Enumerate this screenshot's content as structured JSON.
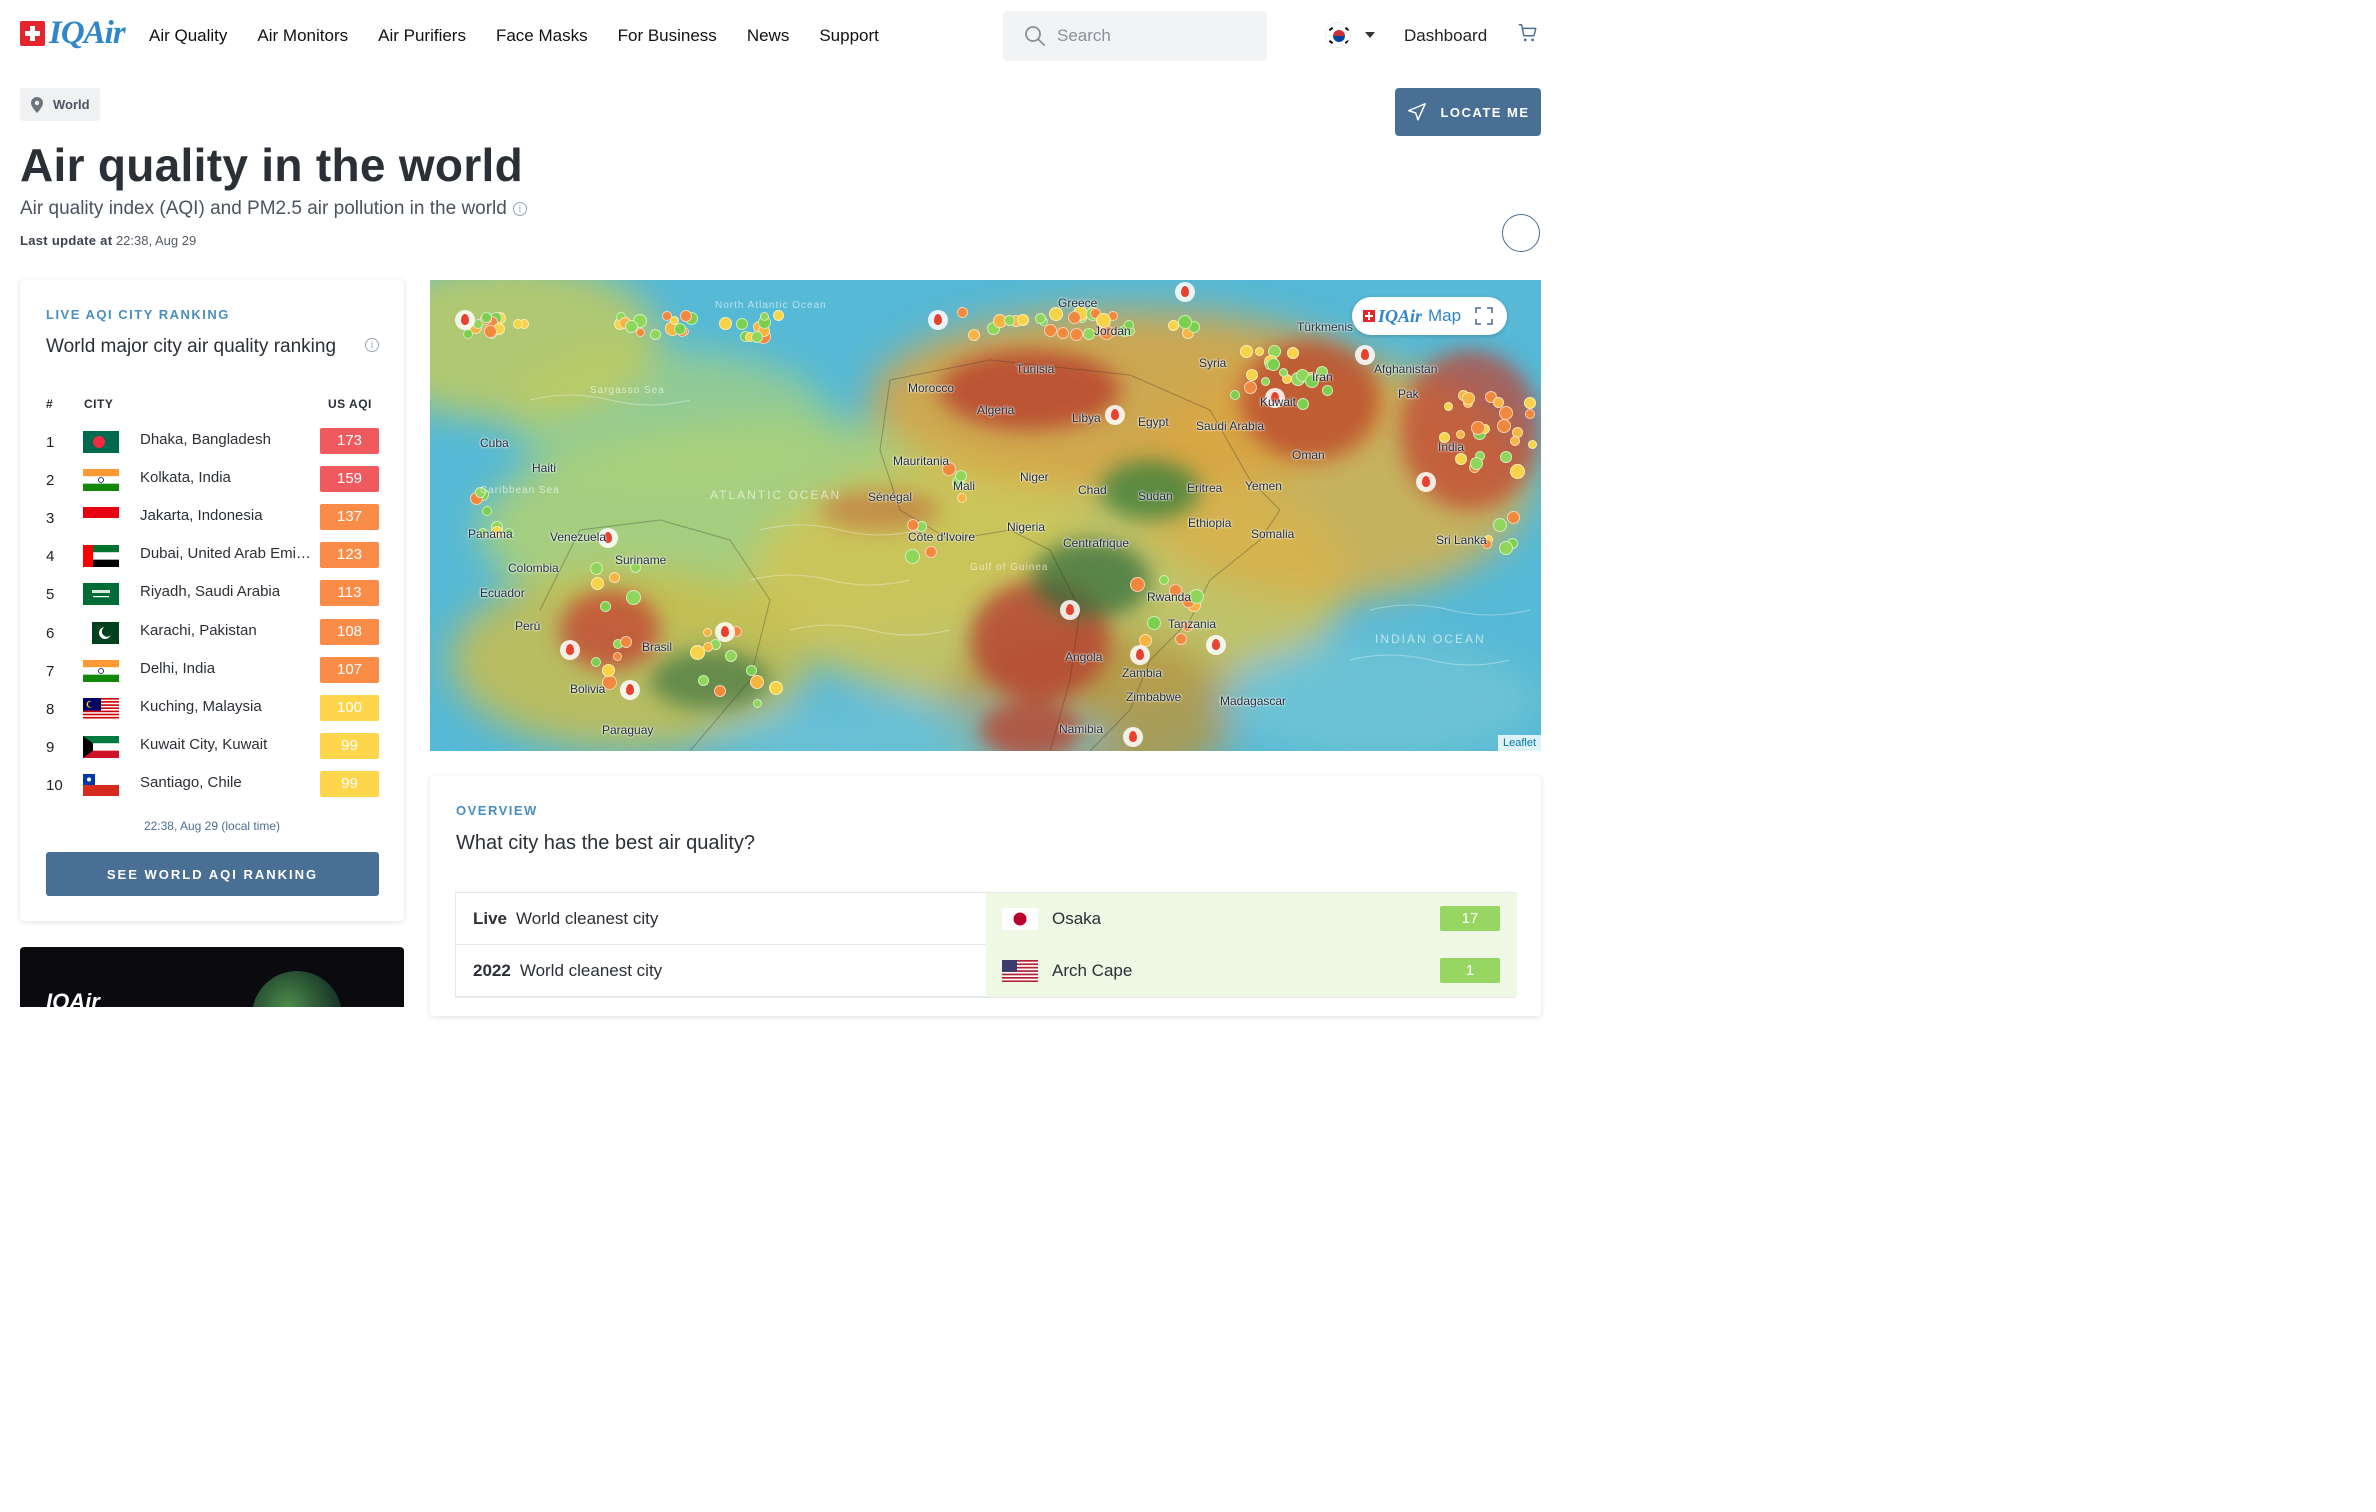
{
  "header": {
    "brand": "IQAir",
    "nav": [
      "Air Quality",
      "Air Monitors",
      "Air Purifiers",
      "Face Masks",
      "For Business",
      "News",
      "Support"
    ],
    "search_placeholder": "Search",
    "dashboard": "Dashboard"
  },
  "breadcrumb": "World",
  "locate_label": "LOCATE ME",
  "page": {
    "title": "Air quality in the world",
    "subtitle": "Air quality index (AQI) and PM2.5 air pollution in the world",
    "last_update_label": "Last update at",
    "last_update_value": "22:38, Aug 29"
  },
  "ranking": {
    "eyebrow": "LIVE AQI CITY RANKING",
    "title": "World major city air quality ranking",
    "col_num": "#",
    "col_city": "CITY",
    "col_aqi": "US AQI",
    "rows": [
      {
        "rank": "1",
        "city": "Dhaka, Bangladesh",
        "aqi": "173",
        "color": "#ef5a5e",
        "flag": "bangladesh-flag"
      },
      {
        "rank": "2",
        "city": "Kolkata, India",
        "aqi": "159",
        "color": "#ef5a5e",
        "flag": "india-flag"
      },
      {
        "rank": "3",
        "city": "Jakarta, Indonesia",
        "aqi": "137",
        "color": "#fb8c48",
        "flag": "indonesia-flag"
      },
      {
        "rank": "4",
        "city": "Dubai, United Arab Emirates",
        "aqi": "123",
        "color": "#fb8c48",
        "flag": "uae-flag"
      },
      {
        "rank": "5",
        "city": "Riyadh, Saudi Arabia",
        "aqi": "113",
        "color": "#fb8c48",
        "flag": "saudi-flag"
      },
      {
        "rank": "6",
        "city": "Karachi, Pakistan",
        "aqi": "108",
        "color": "#fb8c48",
        "flag": "pakistan-flag"
      },
      {
        "rank": "7",
        "city": "Delhi, India",
        "aqi": "107",
        "color": "#fb8c48",
        "flag": "india-flag"
      },
      {
        "rank": "8",
        "city": "Kuching, Malaysia",
        "aqi": "100",
        "color": "#fdd64b",
        "flag": "malaysia-flag"
      },
      {
        "rank": "9",
        "city": "Kuwait City, Kuwait",
        "aqi": "99",
        "color": "#fdd64b",
        "flag": "kuwait-flag"
      },
      {
        "rank": "10",
        "city": "Santiago, Chile",
        "aqi": "99",
        "color": "#fdd64b",
        "flag": "chile-flag"
      }
    ],
    "local_time": "22:38, Aug 29 (local time)",
    "button": "SEE WORLD AQI RANKING"
  },
  "earth_card": {
    "brand": "IQAir"
  },
  "map": {
    "brand": "IQAir",
    "map_word": "Map",
    "attribution": "Leaflet",
    "labels": [
      "Tunisia",
      "Morocco",
      "Algeria",
      "Libya",
      "Egypt",
      "Saudi Arabia",
      "Syria",
      "Iran",
      "Kuwait",
      "Afghanistan",
      "Pak",
      "Türkmenis",
      "Oman",
      "Yemen",
      "India",
      "Sri Lanka",
      "Mauritania",
      "Mali",
      "Niger",
      "Chad",
      "Sudan",
      "Eritrea",
      "Ethiopia",
      "Somalia",
      "Sénégal",
      "Côte d'Ivoire",
      "Nigeria",
      "Centrafrique",
      "Rwanda",
      "Tanzania",
      "Angola",
      "Zambia",
      "Zimbabwe",
      "Madagascar",
      "Namibia",
      "Cuba",
      "Haiti",
      "Panama",
      "Venezuela",
      "Suriname",
      "Colombia",
      "Ecuador",
      "Perú",
      "Brasil",
      "Bolivia",
      "Paraguay",
      "Greece",
      "Jordan"
    ],
    "oceans": [
      "North Atlantic Ocean",
      "Sargasso Sea",
      "Caribbean Sea",
      "ATLANTIC OCEAN",
      "Gulf of Guinea",
      "INDIAN OCEAN"
    ]
  },
  "overview": {
    "eyebrow": "OVERVIEW",
    "question": "What city has the best air quality?",
    "rows": [
      {
        "tag": "Live",
        "label": "World cleanest city",
        "city": "Osaka",
        "aqi": "17",
        "flag": "japan-flag"
      },
      {
        "tag": "2022",
        "label": "World cleanest city",
        "city": "Arch Cape",
        "aqi": "1",
        "flag": "usa-flag"
      }
    ]
  }
}
